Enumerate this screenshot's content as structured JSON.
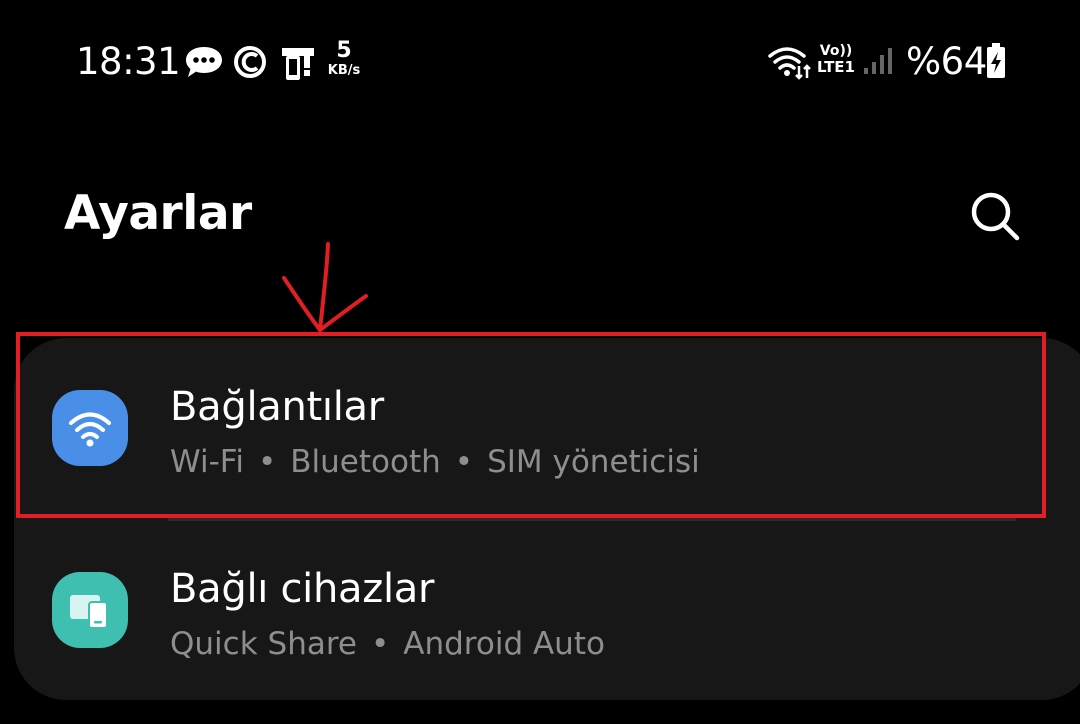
{
  "status_bar": {
    "time": "18:31",
    "net_speed_value": "5",
    "net_speed_unit": "KB/s",
    "volte_top": "Vo))",
    "volte_bottom": "LTE1",
    "battery_percent": "%64",
    "icons": [
      "message-icon",
      "copyright-icon",
      "media-device-icon",
      "wifi-status-icon",
      "signal-icon",
      "battery-charging-icon"
    ]
  },
  "header": {
    "title": "Ayarlar",
    "search_icon": "search-icon"
  },
  "settings_items": [
    {
      "title": "Bağlantılar",
      "subtitle": [
        "Wi-Fi",
        "Bluetooth",
        "SIM yöneticisi"
      ],
      "icon": "wifi-icon",
      "icon_color": "#4a8fe7"
    },
    {
      "title": "Bağlı cihazlar",
      "subtitle": [
        "Quick Share",
        "Android Auto"
      ],
      "icon": "connected-devices-icon",
      "icon_color": "#3ebfb0"
    }
  ],
  "separator": "•",
  "annotation": {
    "highlight_color": "#e01e24",
    "arrow_color": "#e01e24"
  }
}
